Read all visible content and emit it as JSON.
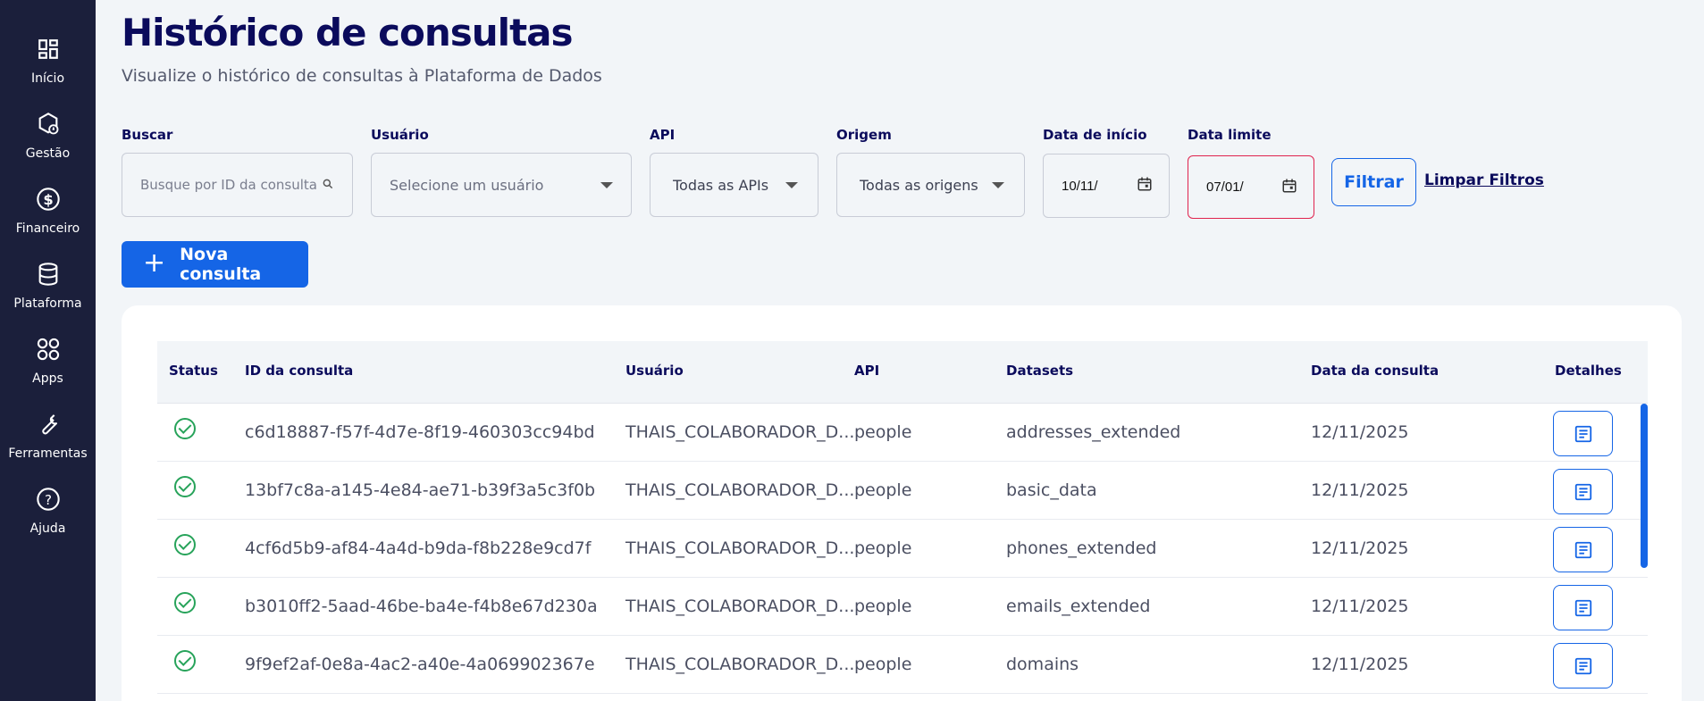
{
  "sidebar": {
    "items": [
      {
        "label": "Início",
        "icon": "dashboard-icon"
      },
      {
        "label": "Gestão",
        "icon": "management-icon"
      },
      {
        "label": "Financeiro",
        "icon": "dollar-icon"
      },
      {
        "label": "Plataforma",
        "icon": "database-icon"
      },
      {
        "label": "Apps",
        "icon": "apps-icon"
      },
      {
        "label": "Ferramentas",
        "icon": "wrench-icon"
      },
      {
        "label": "Ajuda",
        "icon": "help-icon"
      }
    ]
  },
  "header": {
    "title": "Histórico de consultas",
    "subtitle": "Visualize o histórico de consultas à Plataforma de Dados"
  },
  "filters": {
    "search": {
      "label": "Buscar",
      "placeholder": "Busque por ID da consulta"
    },
    "user": {
      "label": "Usuário",
      "value": "Selecione um usuário"
    },
    "api": {
      "label": "API",
      "value": "Todas as APIs"
    },
    "origin": {
      "label": "Origem",
      "value": "Todas as origens"
    },
    "start_date": {
      "label": "Data de início",
      "value": "10/11/"
    },
    "end_date": {
      "label": "Data limite",
      "value": "07/01/"
    },
    "filter_button": "Filtrar",
    "clear_link": "Limpar Filtros"
  },
  "new_query_button": "Nova consulta",
  "table": {
    "headers": [
      "Status",
      "ID da consulta",
      "Usuário",
      "API",
      "Datasets",
      "Data da consulta",
      "Detalhes"
    ],
    "rows": [
      {
        "id": "c6d18887-f57f-4d7e-8f19-460303cc94bd",
        "user": "THAIS_COLABORADOR_D...",
        "api": "people",
        "dataset": "addresses_extended",
        "date": "12/11/2025"
      },
      {
        "id": "13bf7c8a-a145-4e84-ae71-b39f3a5c3f0b",
        "user": "THAIS_COLABORADOR_D...",
        "api": "people",
        "dataset": "basic_data",
        "date": "12/11/2025"
      },
      {
        "id": "4cf6d5b9-af84-4a4d-b9da-f8b228e9cd7f",
        "user": "THAIS_COLABORADOR_D...",
        "api": "people",
        "dataset": "phones_extended",
        "date": "12/11/2025"
      },
      {
        "id": "b3010ff2-5aad-46be-ba4e-f4b8e67d230a",
        "user": "THAIS_COLABORADOR_D...",
        "api": "people",
        "dataset": "emails_extended",
        "date": "12/11/2025"
      },
      {
        "id": "9f9ef2af-0e8a-4ac2-a40e-4a069902367e",
        "user": "THAIS_COLABORADOR_D...",
        "api": "people",
        "dataset": "domains",
        "date": "12/11/2025"
      }
    ]
  },
  "colors": {
    "sidebar_bg": "#1b1f3b",
    "primary": "#1565e6",
    "title": "#0b0b5c",
    "success": "#27a35a",
    "error_border": "#e0234e"
  }
}
